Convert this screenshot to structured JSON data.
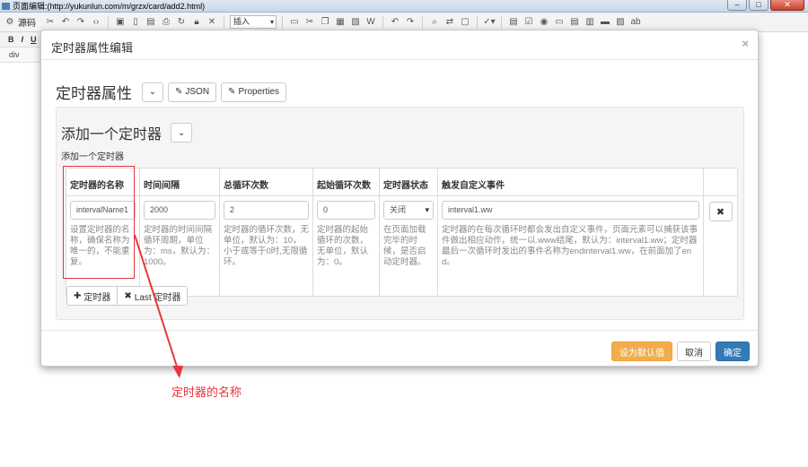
{
  "window": {
    "title": "页面编辑:(http://yukunlun.com/m/grzx/card/add2.html)",
    "min": "–",
    "max": "□",
    "close": "✕"
  },
  "toolbar": {
    "source_label": "源码",
    "insert_select": "插入",
    "format_bold": "B",
    "format_italic": "I",
    "format_underline": "U",
    "path": "div"
  },
  "modal": {
    "title": "定时器属性编辑",
    "close": "×",
    "section_title": "定时器属性",
    "json_button": "JSON",
    "properties_button": "Properties",
    "panel_title": "添加一个定时器",
    "panel_subtitle": "添加一个定时器",
    "columns": [
      "定时器的名称",
      "时间间隔",
      "总循环次数",
      "起始循环次数",
      "定时器状态",
      "触发自定义事件",
      ""
    ],
    "row": {
      "name_value": "intervalName1",
      "name_help": "设置定时器的名称，确保名称为唯一的，不能重复。",
      "interval_value": "2000",
      "interval_help": "定时器的时间间隔循环周期，单位为：ms，默认为：1000。",
      "total_value": "2",
      "total_help": "定时器的循环次数，无单位，默认为：10，小于或等于0时,无限循环。",
      "start_value": "0",
      "start_help": "定时器的起始循环的次数，无单位，默认为：0。",
      "status_value": "关闭",
      "status_help": "在页面加载完毕的时候，是否启动定时器。",
      "event_value": "interval1.ww",
      "event_help": "定时器的在每次循环时都会发出自定义事件，页面元素可以捕获该事件做出相应动作，统一以.www结尾，默认为：interval1.ww；定时器最后一次循环时发出的事件名称为endinterval1.ww，在前面加了end。"
    },
    "add_timer_button": "定时器",
    "last_timer_button": "Last 定时器",
    "default_button": "设为默认值",
    "cancel_button": "取消",
    "ok_button": "确定"
  },
  "annotation": {
    "label": "定时器的名称"
  },
  "colors": {
    "annotation": "#e8343b",
    "primary": "#337ab7",
    "warning": "#f0ad4e"
  }
}
